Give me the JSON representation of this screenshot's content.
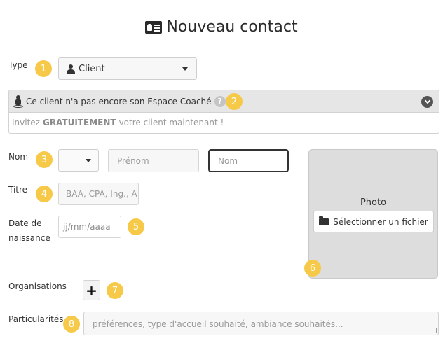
{
  "header": {
    "title": "Nouveau contact",
    "icon": "contact-card-icon"
  },
  "type_field": {
    "label": "Type",
    "badge": "1",
    "selected": "Client",
    "icon": "user-icon"
  },
  "espace": {
    "badge": "2",
    "message": "Ce client n'a pas encore son Espace Coaché",
    "help": "?",
    "invite_prefix": "Invitez",
    "invite_bold": "GRATUITEMENT",
    "invite_suffix": "votre client maintenant !"
  },
  "name_field": {
    "label": "Nom",
    "badge": "3",
    "civility": "",
    "first_name_placeholder": "Prénom",
    "last_name_placeholder": "Nom"
  },
  "title_field": {
    "label": "Titre",
    "badge": "4",
    "placeholder": "BAA, CPA, Ing., A"
  },
  "birth_field": {
    "label_line1": "Date de",
    "label_line2": "naissance",
    "badge": "5",
    "placeholder": "jj/mm/aaaa"
  },
  "photo": {
    "label": "Photo",
    "button": "Sélectionner un fichier",
    "badge": "6"
  },
  "organisations": {
    "label": "Organisations",
    "badge": "7",
    "add": "+"
  },
  "particularites": {
    "label": "Particularités",
    "badge": "8",
    "placeholder": "préférences, type d'accueil souhaité, ambiance souhaités..."
  },
  "colors": {
    "badge": "#f7c948",
    "panel": "#e6e6e6",
    "photo_bg": "#dddddd"
  }
}
